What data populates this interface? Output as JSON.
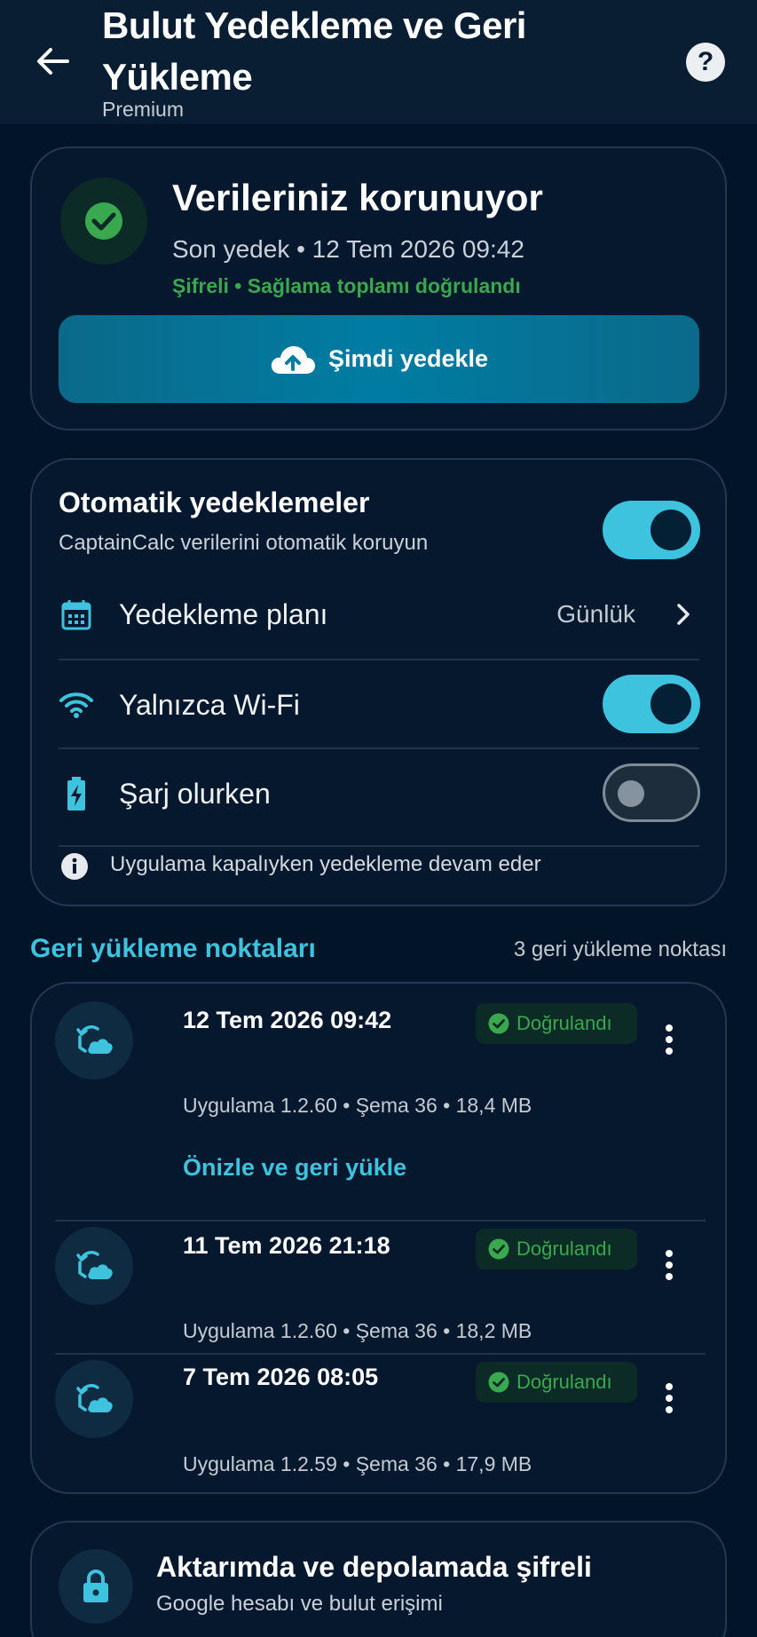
{
  "header": {
    "title": "Bulut Yedekleme ve Geri Yükleme",
    "subtitle": "Premium",
    "back_icon": "arrow-left-icon",
    "help_icon": "help-circle-icon"
  },
  "status": {
    "title": "Verileriniz korunuyor",
    "last_backup": "Son yedek • 12 Tem 2026 09:42",
    "verified": "Şifreli • Sağlama toplamı doğrulandı",
    "backup_button": "Şimdi yedekle",
    "icon": "check-circle-icon"
  },
  "auto": {
    "title": "Otomatik yedeklemeler",
    "subtitle": "CaptainCalc verilerini otomatik koruyun",
    "enabled": true,
    "schedule": {
      "label": "Yedekleme planı",
      "value": "Günlük",
      "icon": "calendar-icon"
    },
    "wifi_only": {
      "label": "Yalnızca Wi-Fi",
      "enabled": true,
      "icon": "wifi-icon"
    },
    "charging": {
      "label": "Şarj olurken",
      "enabled": false,
      "icon": "battery-charging-icon"
    },
    "info": "Uygulama kapalıyken yedekleme devam eder"
  },
  "restore": {
    "title": "Geri yükleme noktaları",
    "count": "3 geri yükleme noktası",
    "points": [
      {
        "date": "12 Tem 2026 09:42",
        "badge": "Doğrulandı",
        "meta": "Uygulama 1.2.60 • Şema 36 • 18,4 MB",
        "action": "Önizle ve geri yükle"
      },
      {
        "date": "11 Tem 2026 21:18",
        "badge": "Doğrulandı",
        "meta": "Uygulama 1.2.60 • Şema 36 • 18,2 MB"
      },
      {
        "date": "7 Tem 2026 08:05",
        "badge": "Doğrulandı",
        "meta": "Uygulama 1.2.59 • Şema 36 • 17,9 MB"
      }
    ]
  },
  "security": {
    "title": "Aktarımda ve depolamada şifreli",
    "subtitle": "Google hesabı ve bulut erişimi",
    "icon": "lock-icon"
  },
  "colors": {
    "background": "#021428",
    "accent": "#3dc3dd",
    "success": "#3aa84e",
    "button": "#007ca3"
  }
}
